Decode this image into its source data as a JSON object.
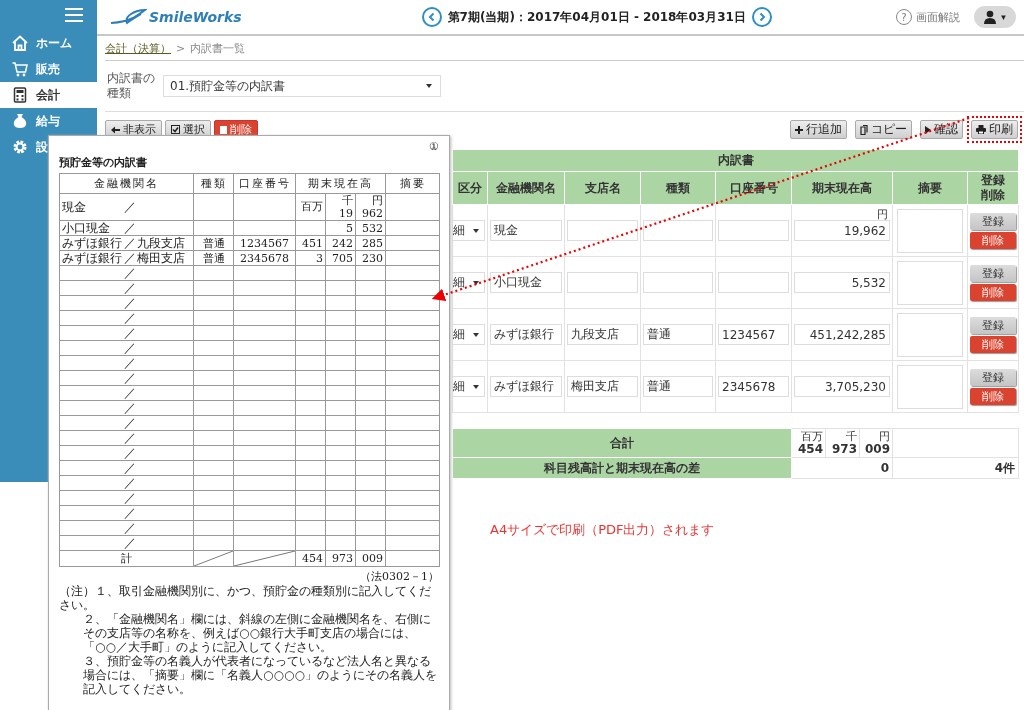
{
  "sidebar": {
    "items": [
      {
        "label": "ホーム",
        "selected": false
      },
      {
        "label": "販売",
        "selected": false
      },
      {
        "label": "会計",
        "selected": true
      },
      {
        "label": "給与",
        "selected": false
      },
      {
        "label": "設",
        "selected": false
      }
    ]
  },
  "header": {
    "logo": "SmileWorks",
    "period": "第7期(当期)：2017年04月01日 - 2018年03月31日",
    "help_glyph": "?",
    "help": "画面解説",
    "user_caret": "▼"
  },
  "breadcrumb": {
    "parent": "会計（決算）",
    "separator": ">",
    "current": "内訳書一覧"
  },
  "selector": {
    "label": "内訳書の種類",
    "value": "01.預貯金等の内訳書"
  },
  "toolbar_left": [
    {
      "label": "非表示",
      "kind": "hide"
    },
    {
      "label": "選択",
      "kind": "select"
    },
    {
      "label": "削除",
      "kind": "delete"
    }
  ],
  "toolbar_right": [
    {
      "label": "行追加",
      "kind": "add",
      "highlighted": false
    },
    {
      "label": "コピー",
      "kind": "copy",
      "highlighted": false
    },
    {
      "label": "確認",
      "kind": "confirm",
      "highlighted": false
    },
    {
      "label": "印刷",
      "kind": "print",
      "highlighted": true
    }
  ],
  "table": {
    "title": "内訳書",
    "columns": [
      "区分",
      "金融機関名",
      "支店名",
      "種類",
      "口座番号",
      "期末現在高",
      "摘要",
      "登録削除"
    ],
    "rows": [
      {
        "category": "細",
        "bank": "現金",
        "unit": "円",
        "amount": "19,962",
        "register": "登録",
        "delete": "削除"
      },
      {
        "category": "細",
        "bank": "小口現金",
        "amount": "5,532",
        "register": "登録",
        "delete": "削除"
      },
      {
        "category": "細",
        "bank": "みずほ銀行",
        "branch": "九段支店",
        "type": "普通",
        "account": "1234567",
        "amount": "451,242,285",
        "register": "登録",
        "delete": "削除"
      },
      {
        "category": "細",
        "bank": "みずほ銀行",
        "branch": "梅田支店",
        "type": "普通",
        "account": "2345678",
        "amount": "3,705,230",
        "register": "登録",
        "delete": "削除"
      }
    ]
  },
  "totals": {
    "label": "合計",
    "units": [
      "百万",
      "千",
      "円"
    ],
    "values": [
      "454",
      "973",
      "009"
    ]
  },
  "difference": {
    "label": "科目残高計と期末現在高の差",
    "value": "0",
    "count": "4件"
  },
  "caption": "A4サイズで印刷（PDF出力）されます",
  "document": {
    "page_mark": "①",
    "title": "預貯金等の内訳書",
    "columns": [
      "金融機関名",
      "種類",
      "口座番号",
      "期末現在高",
      "摘要"
    ],
    "units": [
      "百万",
      "千",
      "円"
    ],
    "rows": [
      {
        "bank": "現金",
        "slash": "／",
        "thousands": "19",
        "yen": "962"
      },
      {
        "bank": "小口現金",
        "slash": "／",
        "thousands": "5",
        "yen": "532"
      },
      {
        "bank": "みずほ銀行",
        "slash": "／",
        "branch": "九段支店",
        "type": "普通",
        "account": "1234567",
        "millions": "451",
        "thousands": "242",
        "yen": "285"
      },
      {
        "bank": "みずほ銀行",
        "slash": "／",
        "branch": "梅田支店",
        "type": "普通",
        "account": "2345678",
        "millions": "3",
        "thousands": "705",
        "yen": "230"
      },
      {
        "slash": "／"
      },
      {
        "slash": "／"
      },
      {
        "slash": "／"
      },
      {
        "slash": "／"
      },
      {
        "slash": "／"
      },
      {
        "slash": "／"
      },
      {
        "slash": "／"
      },
      {
        "slash": "／"
      },
      {
        "slash": "／"
      },
      {
        "slash": "／"
      },
      {
        "slash": "／"
      },
      {
        "slash": "／"
      },
      {
        "slash": "／"
      },
      {
        "slash": "／"
      },
      {
        "slash": "／"
      },
      {
        "slash": "／"
      },
      {
        "slash": "／"
      },
      {
        "slash": "／"
      },
      {
        "slash": "／"
      }
    ],
    "total": {
      "label": "計",
      "millions": "454",
      "thousands": "973",
      "yen": "009"
    },
    "form_code": "（法0302－1）",
    "notes": [
      "（注）１、取引金融機関別に、かつ、預貯金の種類別に記入してください。",
      "２、「金融機関名」欄には、斜線の左側に金融機関名を、右側にその支店等の名称を、例えば○○銀行大手町支店の場合には、「○○／大手町」のように記入してください。",
      "３、預貯金等の名義人が代表者になっているなど法人名と異なる場合には、「摘要」欄に「名義人○○○○」のようにその名義人を記入してください。"
    ]
  }
}
